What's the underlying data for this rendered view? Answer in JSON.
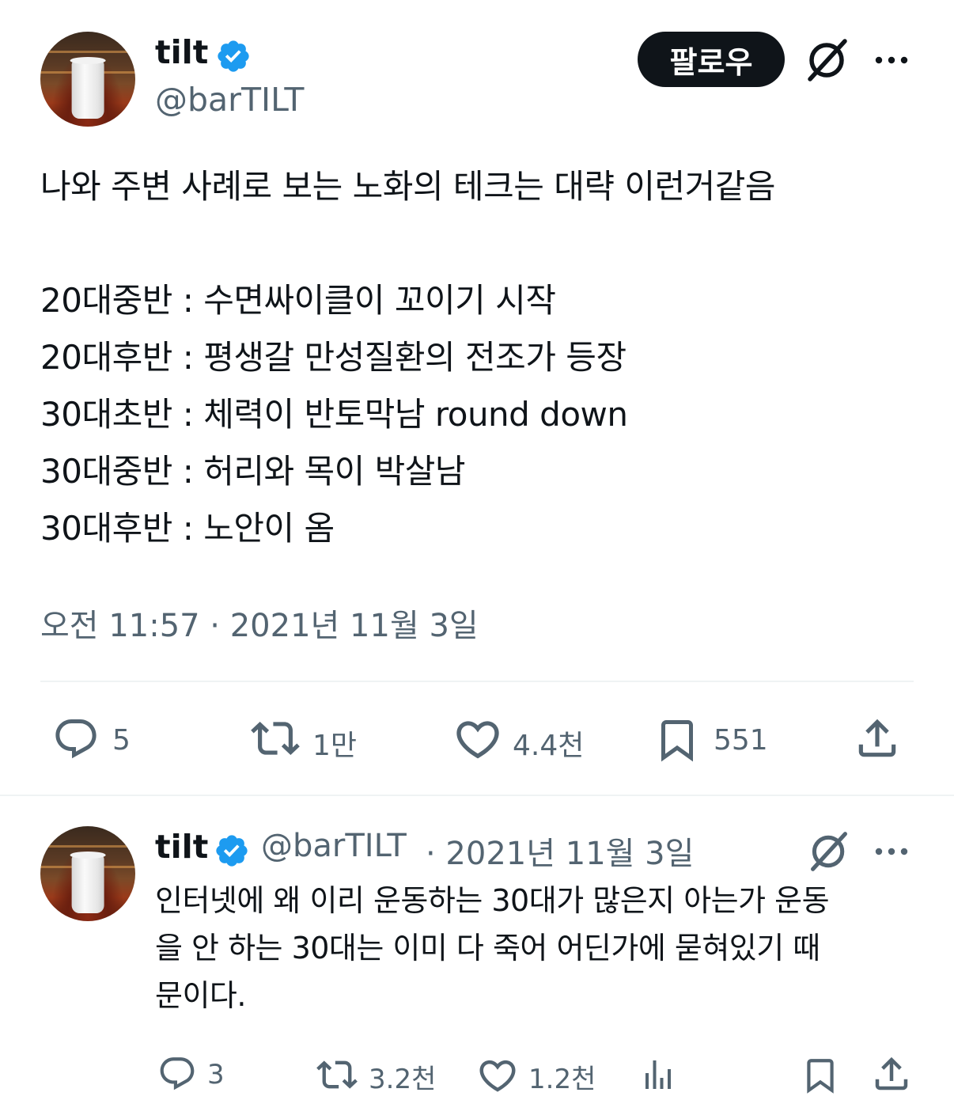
{
  "main_tweet": {
    "author_name": "tilt",
    "author_handle": "@barTILT",
    "follow_label": "팔로우",
    "text_lines": [
      "나와 주변 사례로 보는 노화의 테크는 대략 이런거같음",
      "",
      "20대중반 : 수면싸이클이 꼬이기 시작",
      "20대후반 : 평생갈 만성질환의 전조가 등장",
      "30대초반 : 체력이 반토막남 round down",
      "30대중반 : 허리와 목이 박살남",
      "30대후반 : 노안이 옴"
    ],
    "timestamp": "오전 11:57 · 2021년 11월 3일",
    "stats": {
      "replies": "5",
      "retweets": "1만",
      "likes": "4.4천",
      "bookmarks": "551"
    }
  },
  "reply_tweet": {
    "author_name": "tilt",
    "author_handle": "@barTILT",
    "date": "· 2021년 11월 3일",
    "text_lines": [
      "인터넷에 왜 이리 운동하는 30대가 많은지 아는가 운동",
      "을 안 하는 30대는 이미 다 죽어 어딘가에 묻혀있기 때",
      "문이다."
    ],
    "stats": {
      "replies": "3",
      "retweets": "3.2천",
      "likes": "1.2천"
    }
  },
  "colors": {
    "verified": "#1d9bf0",
    "text": "#0f1419",
    "secondary": "#536471",
    "divider": "#eff3f4"
  },
  "icons": [
    "verified-badge-icon",
    "grok-icon",
    "more-icon",
    "reply-icon",
    "retweet-icon",
    "like-icon",
    "bookmark-icon",
    "share-icon",
    "views-icon"
  ]
}
